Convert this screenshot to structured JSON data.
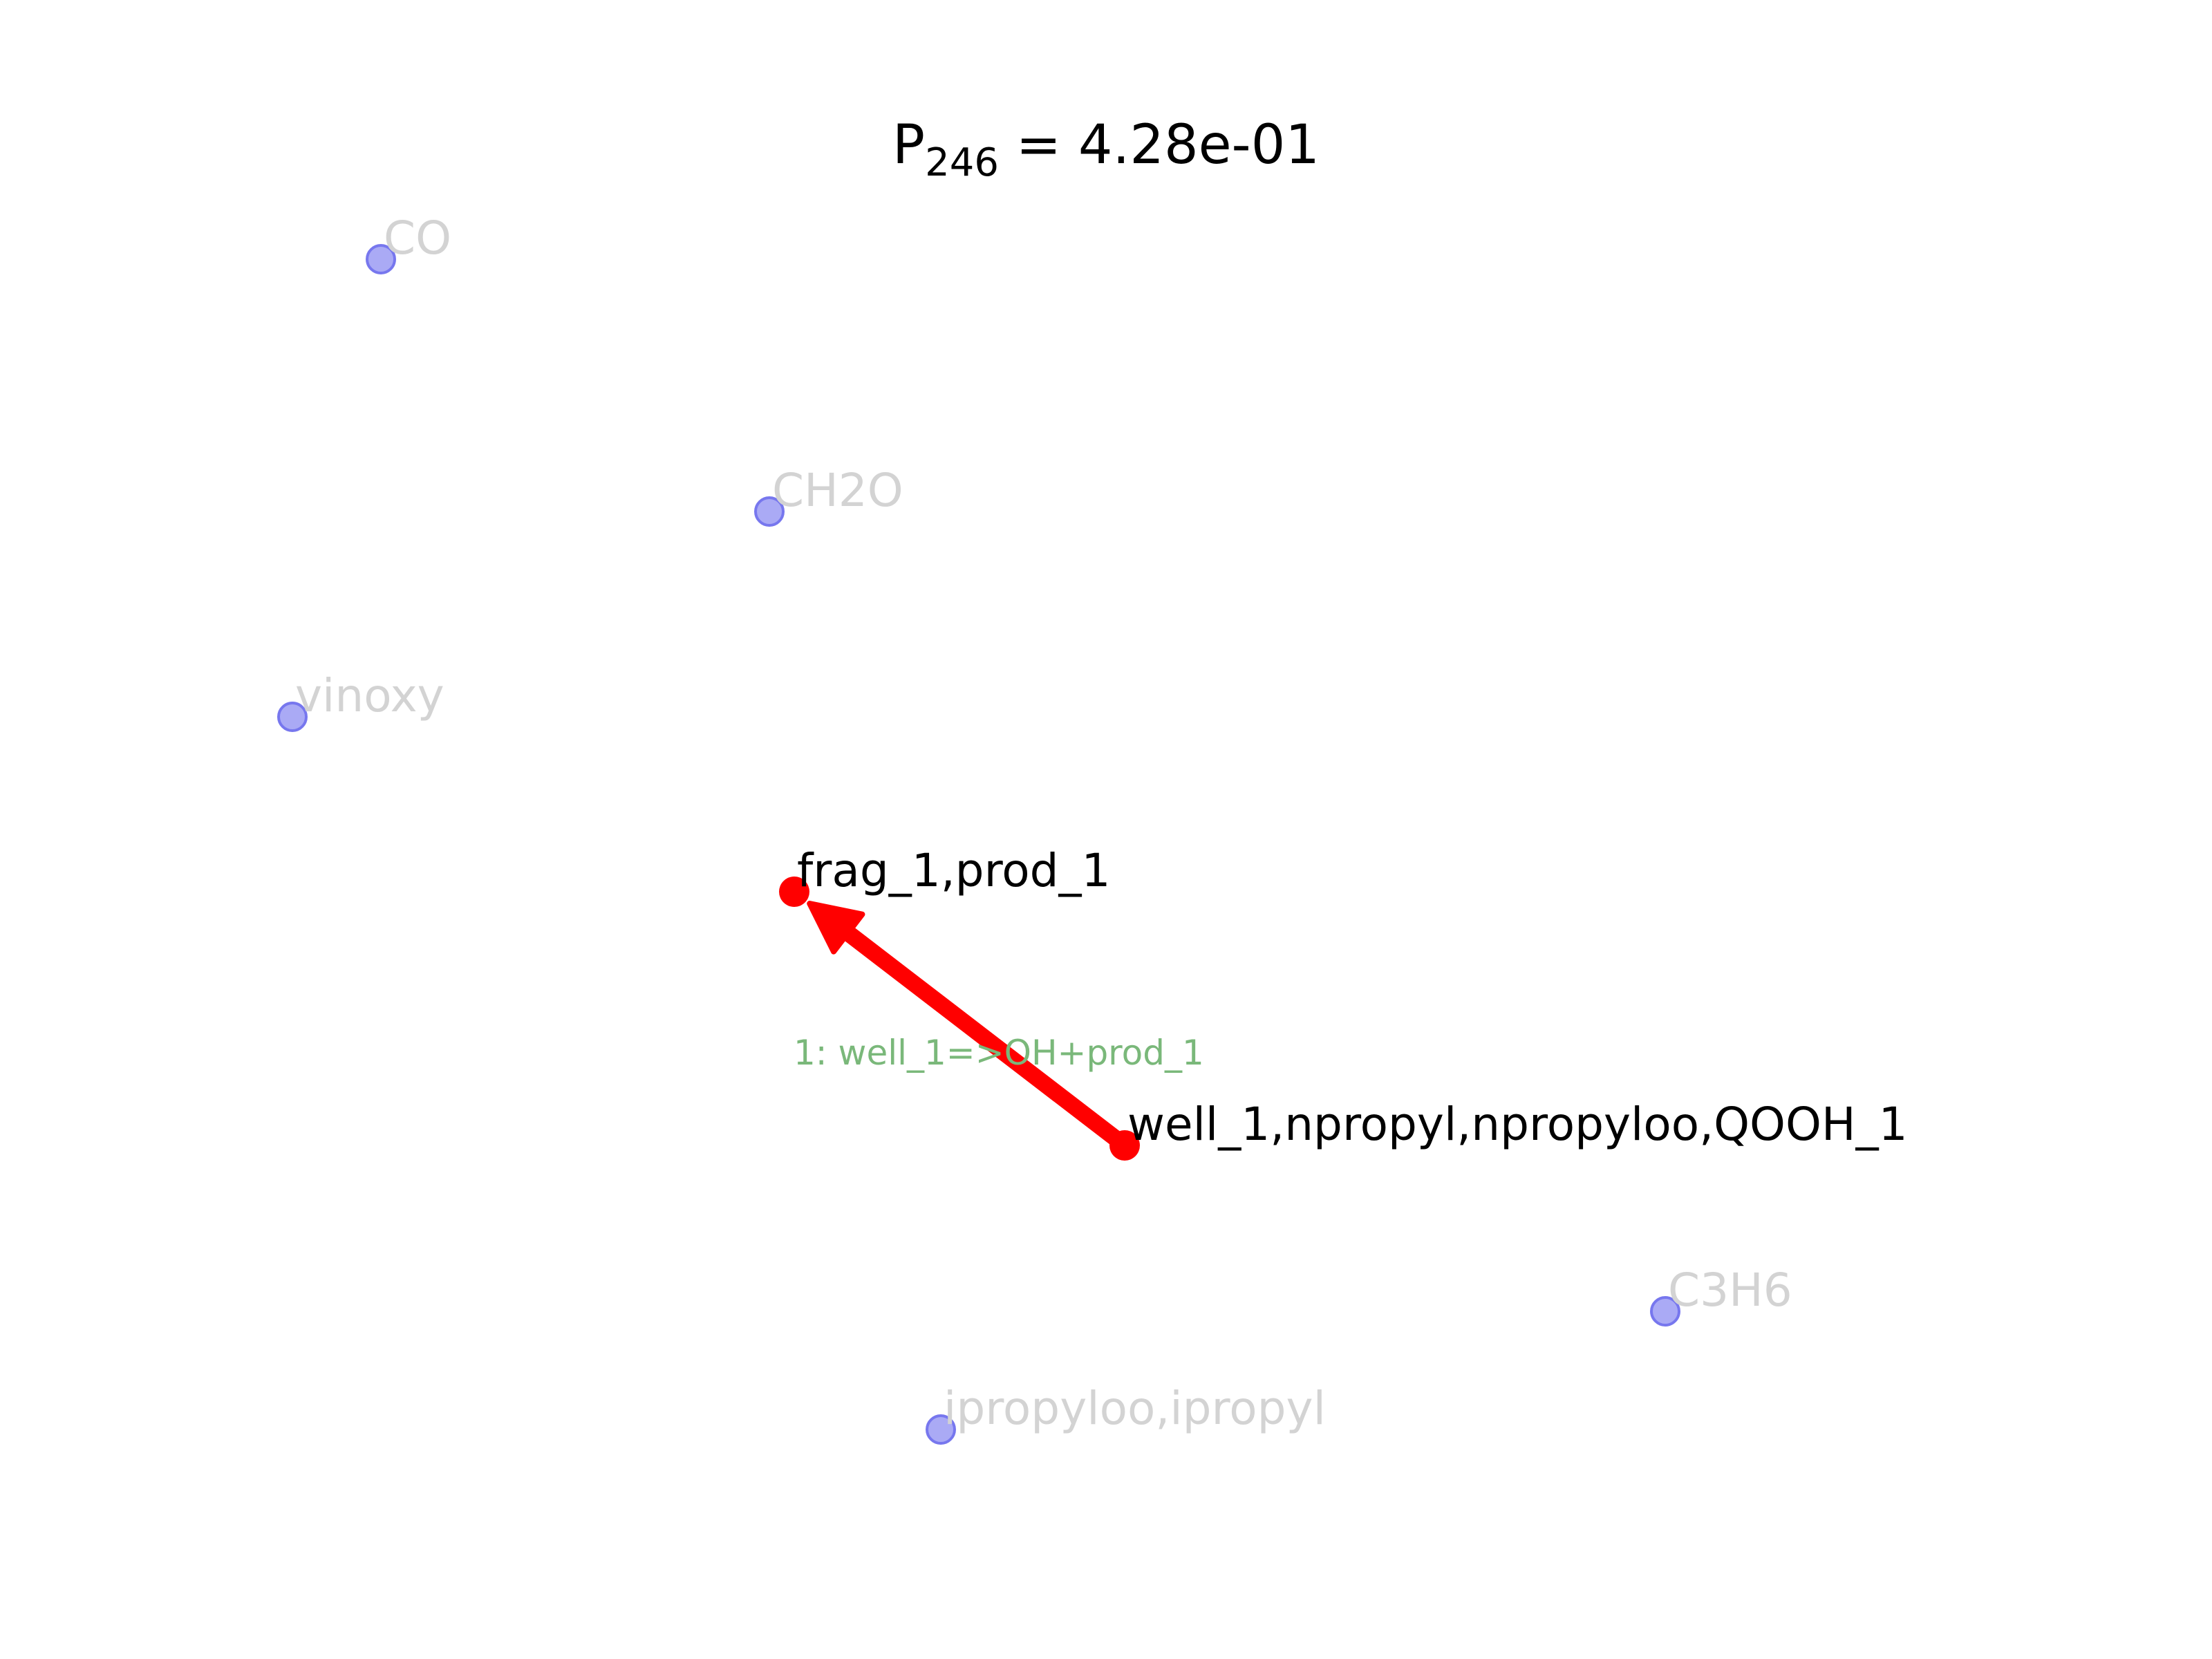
{
  "title": {
    "main": "P",
    "subscript": "246",
    "rest": " = 4.28e-01"
  },
  "colors": {
    "active_node": "#ff0000",
    "inactive_node_fill": "#aaaaf5",
    "inactive_node_stroke": "#7777ee",
    "active_label": "#000000",
    "inactive_label": "#d3d3d3",
    "edge": "#ff0000",
    "edge_label": "#7ab87a"
  },
  "nodes": [
    {
      "id": "co",
      "label": "CO",
      "active": false
    },
    {
      "id": "ch2o",
      "label": "CH2O",
      "active": false
    },
    {
      "id": "vinoxy",
      "label": "vinoxy",
      "active": false
    },
    {
      "id": "frag",
      "label": "frag_1,prod_1",
      "active": true
    },
    {
      "id": "well",
      "label": "well_1,npropyl,npropyloo,QOOH_1",
      "active": true
    },
    {
      "id": "c3h6",
      "label": "C3H6",
      "active": false
    },
    {
      "id": "ipropyl",
      "label": "ipropyloo,ipropyl",
      "active": false
    }
  ],
  "edges": [
    {
      "from": "well",
      "to": "frag",
      "label": "1: well_1=>OH+prod_1"
    }
  ]
}
